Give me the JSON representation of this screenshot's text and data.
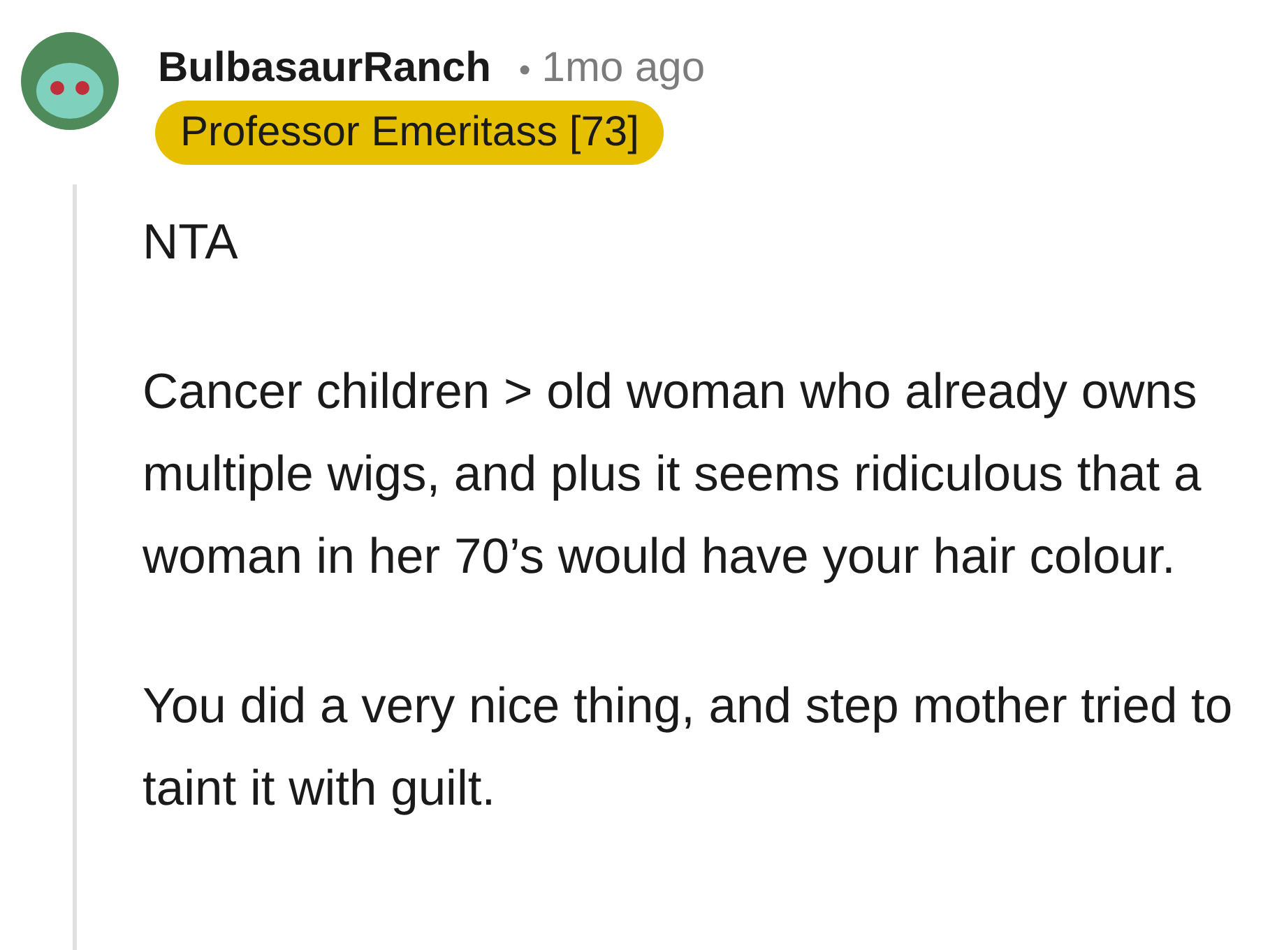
{
  "comment": {
    "author": "BulbasaurRanch",
    "separator": "•",
    "time": "1mo ago",
    "flair": "Professor Emeritass [73]",
    "paragraphs": [
      "NTA",
      "Cancer children > old woman who already owns multiple wigs, and plus it seems ridiculous that a woman in her 70’s would have your hair colour.",
      "You did a very nice thing, and step mother tried to taint it with guilt."
    ]
  }
}
